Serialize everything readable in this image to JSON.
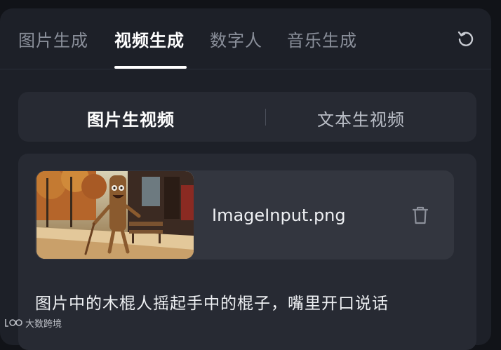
{
  "tabs": [
    {
      "label": "图片生成"
    },
    {
      "label": "视频生成"
    },
    {
      "label": "数字人"
    },
    {
      "label": "音乐生成"
    }
  ],
  "active_tab": "视频生成",
  "mode_switch": {
    "options": [
      {
        "label": "图片生视频"
      },
      {
        "label": "文本生视频"
      }
    ],
    "active": "图片生视频"
  },
  "upload": {
    "filename": "ImageInput.png"
  },
  "prompt": {
    "text": "图片中的木棍人摇起手中的棍子，嘴里开口说话"
  },
  "watermark": {
    "text": "大数跨境"
  },
  "icons": {
    "refresh": "refresh-icon",
    "delete": "trash-icon"
  },
  "colors": {
    "background": "#111318",
    "panel": "#1d2028",
    "card": "#272a33",
    "file_card": "#33363f",
    "active_text": "#ffffff",
    "inactive_text": "#8a8f9a"
  }
}
